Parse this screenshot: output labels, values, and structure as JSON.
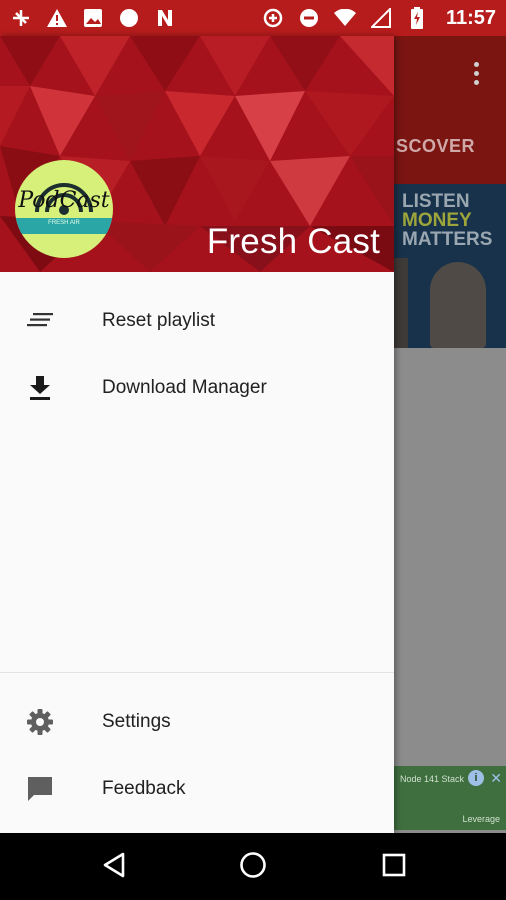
{
  "status_bar": {
    "time": "11:57",
    "icons_left": [
      "tools-icon",
      "warning-icon",
      "image-icon",
      "circle-icon",
      "n-icon"
    ],
    "icons_right": [
      "data-saver-icon",
      "do-not-disturb-icon",
      "wifi-icon",
      "no-signal-icon",
      "battery-charging-icon"
    ],
    "color": "#b71c1c"
  },
  "background_app": {
    "tab_label": "SCOVER",
    "banner": {
      "line1": "LISTEN",
      "line2": "MONEY",
      "line3": "MATTERS"
    },
    "ad": {
      "text": "Node 141 Stack",
      "footer": "Leverage"
    }
  },
  "drawer": {
    "header": {
      "title": "Fresh Cast",
      "logo_text": "PodCast",
      "logo_subtext": "FRESH AIR",
      "color": "#a5121b"
    },
    "items": [
      {
        "label": "Reset playlist",
        "icon": "playlist-icon"
      },
      {
        "label": "Download Manager",
        "icon": "download-icon"
      }
    ],
    "bottom_items": [
      {
        "label": "Settings",
        "icon": "gear-icon"
      },
      {
        "label": "Feedback",
        "icon": "feedback-icon"
      }
    ]
  },
  "nav_bar": {
    "buttons": [
      "back-icon",
      "home-icon",
      "recents-icon"
    ]
  }
}
